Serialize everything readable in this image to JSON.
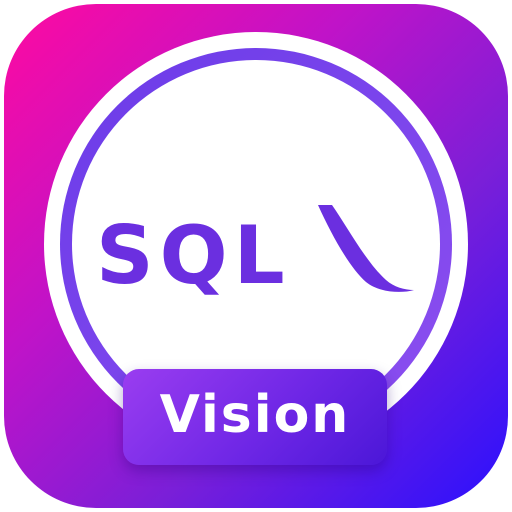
{
  "logo": {
    "wordmark": "SQL",
    "badge_label": "Vision"
  },
  "colors": {
    "gradient_start": "#ff0aa0",
    "gradient_end": "#2a10ff",
    "ring": "#7b3fe6",
    "wordmark": "#6b2fe0",
    "badge": "#6f27e6"
  }
}
